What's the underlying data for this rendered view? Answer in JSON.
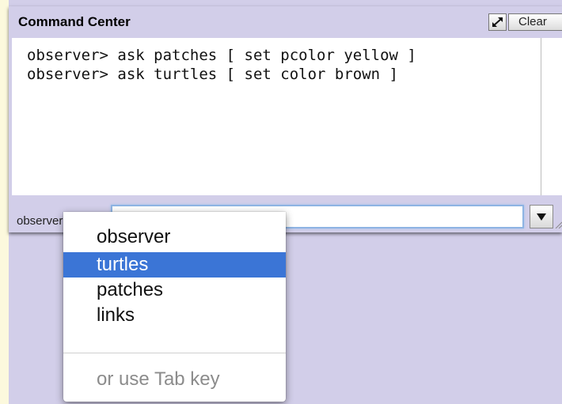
{
  "command_center": {
    "title": "Command Center",
    "clear_label": "Clear",
    "history_lines": [
      "observer> ask patches [ set pcolor yellow ]",
      "observer> ask turtles [ set color brown ]"
    ],
    "agent_prompt": "observer>",
    "input_value": ""
  },
  "agent_menu": {
    "items": [
      "observer",
      "turtles",
      "patches",
      "links"
    ],
    "selected": "turtles",
    "hint": "or use Tab key"
  },
  "colors": {
    "background": "#fcf9dd",
    "panel": "#d2cee9",
    "selection": "#3b75d6",
    "input_focus": "#8eb4e3"
  },
  "icons": {
    "expand": "expand-arrows-icon",
    "dropdown": "triangle-down-icon",
    "resize": "resize-grip-icon"
  }
}
